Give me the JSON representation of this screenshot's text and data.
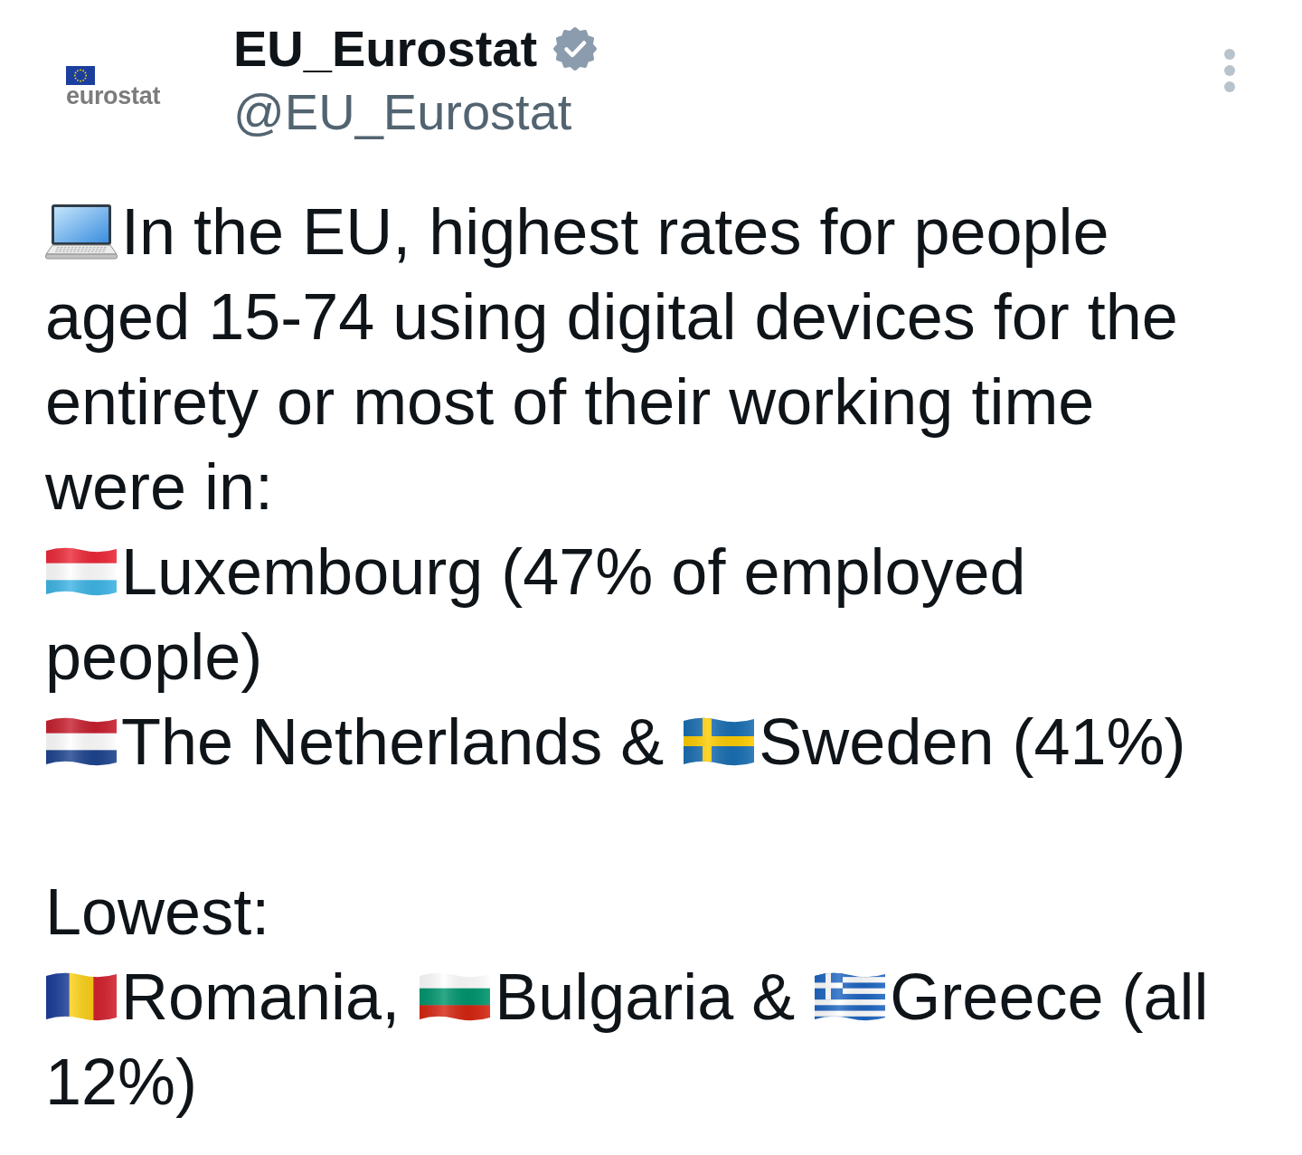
{
  "post": {
    "author": {
      "avatar": {
        "logo_text": "eurostat"
      },
      "name": "EU_Eurostat",
      "verified": true,
      "handle": "@EU_Eurostat"
    },
    "paragraphs": [
      {
        "lines": [
          {
            "parts": [
              {
                "kind": "laptop"
              },
              {
                "kind": "text",
                "text": "In the EU, highest rates for people"
              }
            ]
          },
          {
            "parts": [
              {
                "kind": "text",
                "text": "aged 15-74 using digital devices for the"
              }
            ]
          },
          {
            "parts": [
              {
                "kind": "text",
                "text": "entirety or most of their working time"
              }
            ]
          },
          {
            "parts": [
              {
                "kind": "text",
                "text": "were in:"
              }
            ]
          },
          {
            "parts": [
              {
                "kind": "luxembourg"
              },
              {
                "kind": "text",
                "text": "Luxembourg (47% of employed"
              }
            ]
          },
          {
            "parts": [
              {
                "kind": "text",
                "text": "people)"
              }
            ]
          },
          {
            "parts": [
              {
                "kind": "netherlands"
              },
              {
                "kind": "text",
                "text": "The Netherlands &"
              },
              {
                "kind": "sweden"
              },
              {
                "kind": "text",
                "text": "Sweden (41%)"
              }
            ]
          }
        ]
      },
      {
        "lines": [
          {
            "parts": [
              {
                "kind": "text",
                "text": "Lowest:"
              }
            ]
          },
          {
            "parts": [
              {
                "kind": "romania"
              },
              {
                "kind": "text",
                "text": "Romania,"
              },
              {
                "kind": "bulgaria"
              },
              {
                "kind": "text",
                "text": "Bulgaria &"
              },
              {
                "kind": "greece"
              },
              {
                "kind": "text",
                "text": "Greece (all"
              }
            ]
          },
          {
            "parts": [
              {
                "kind": "text",
                "text": "12%)"
              }
            ]
          }
        ]
      }
    ]
  }
}
